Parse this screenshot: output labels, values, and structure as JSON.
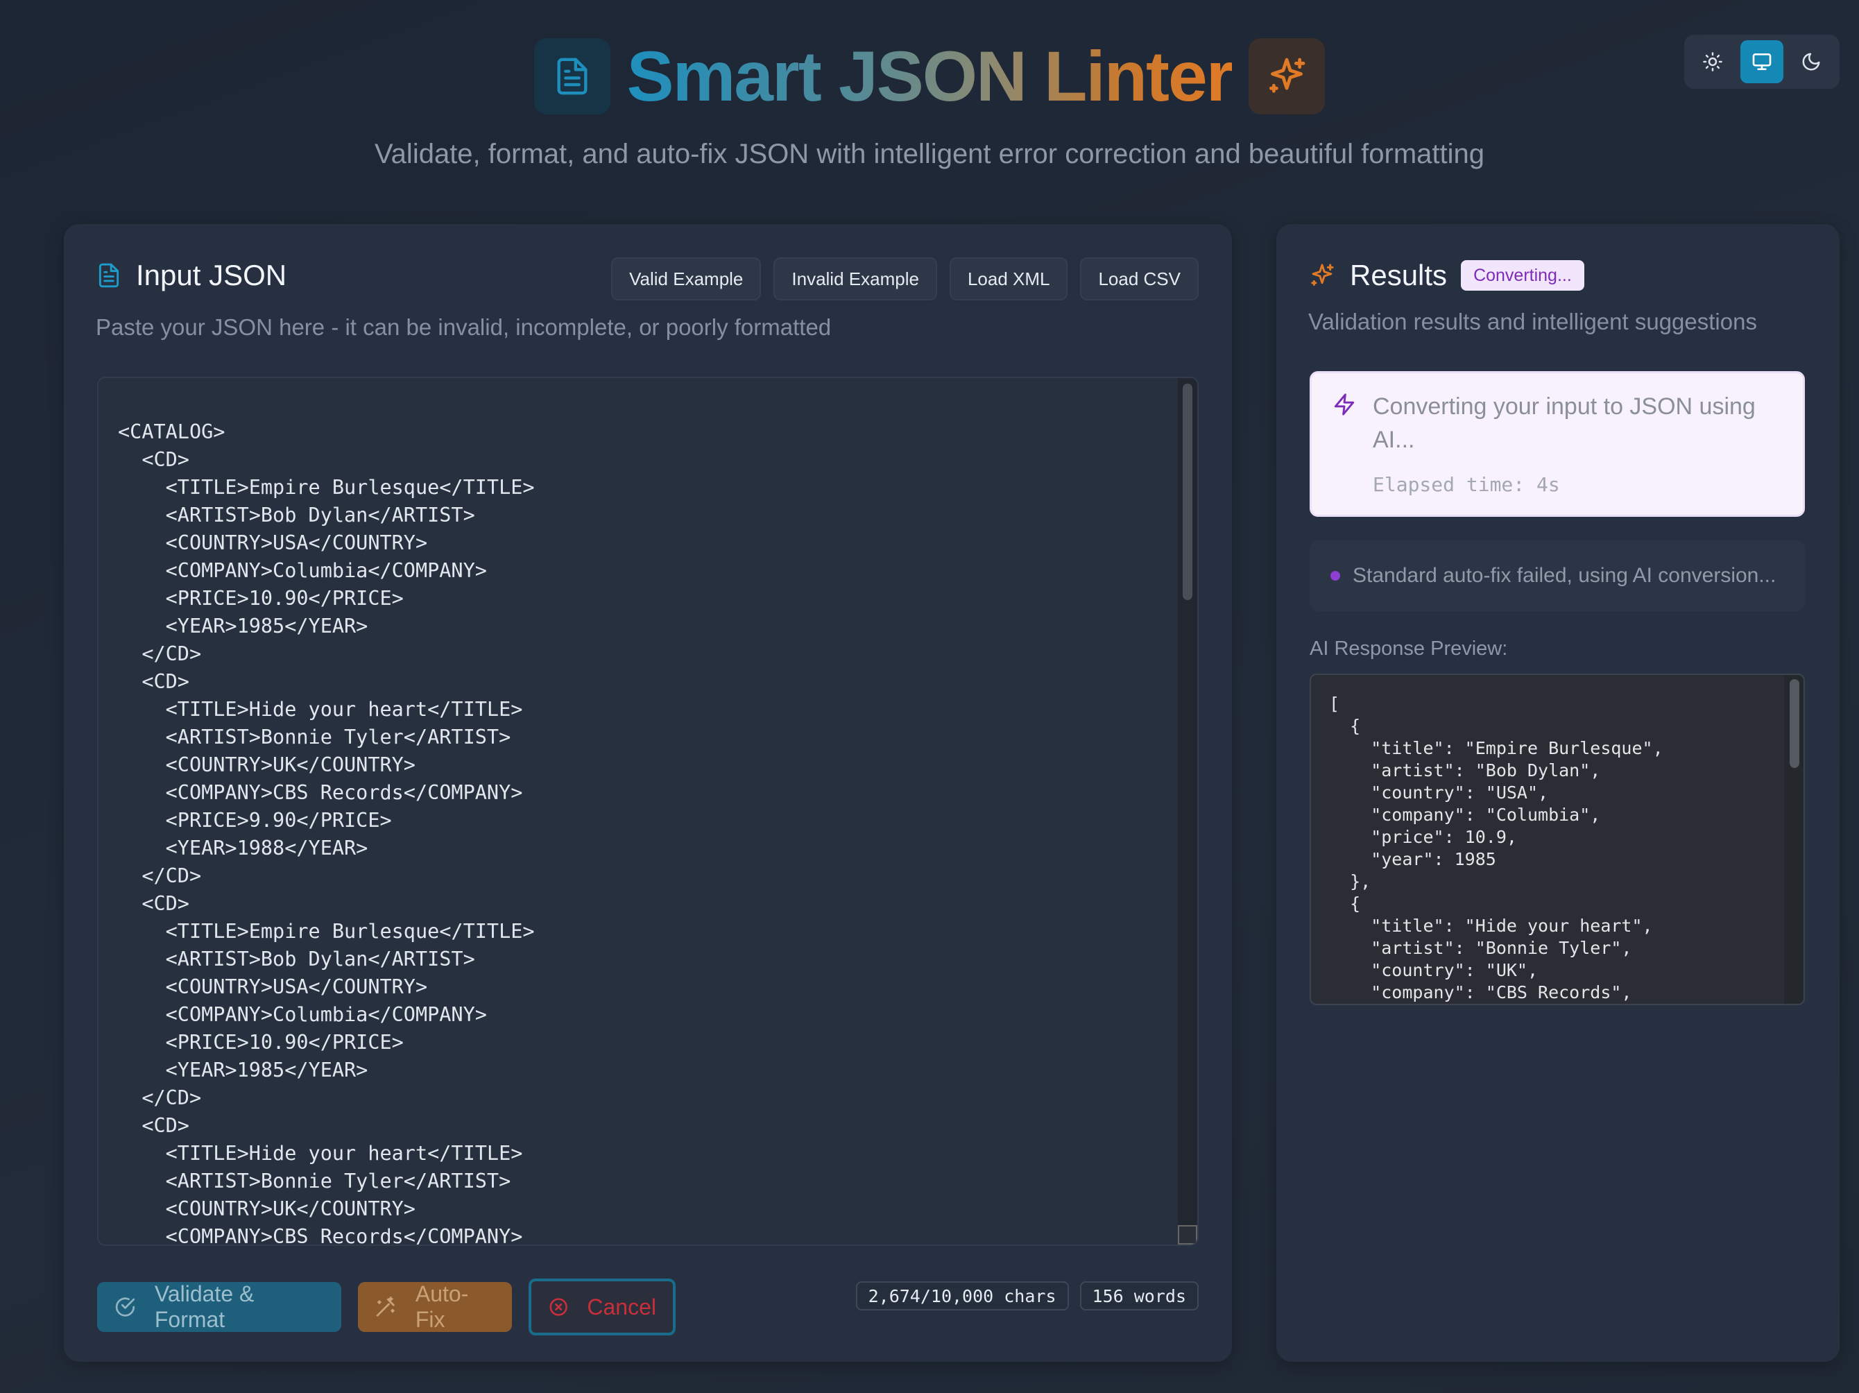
{
  "header": {
    "title": "Smart JSON Linter",
    "subtitle": "Validate, format, and auto-fix JSON with intelligent error correction and beautiful formatting",
    "theme_options": [
      "light",
      "system",
      "dark"
    ],
    "active_theme": "system"
  },
  "input_panel": {
    "title": "Input JSON",
    "description": "Paste your JSON here - it can be invalid, incomplete, or poorly formatted",
    "example_buttons": [
      "Valid Example",
      "Invalid Example",
      "Load XML",
      "Load CSV"
    ],
    "editor_content": "<CATALOG>\n  <CD>\n    <TITLE>Empire Burlesque</TITLE>\n    <ARTIST>Bob Dylan</ARTIST>\n    <COUNTRY>USA</COUNTRY>\n    <COMPANY>Columbia</COMPANY>\n    <PRICE>10.90</PRICE>\n    <YEAR>1985</YEAR>\n  </CD>\n  <CD>\n    <TITLE>Hide your heart</TITLE>\n    <ARTIST>Bonnie Tyler</ARTIST>\n    <COUNTRY>UK</COUNTRY>\n    <COMPANY>CBS Records</COMPANY>\n    <PRICE>9.90</PRICE>\n    <YEAR>1988</YEAR>\n  </CD>\n  <CD>\n    <TITLE>Empire Burlesque</TITLE>\n    <ARTIST>Bob Dylan</ARTIST>\n    <COUNTRY>USA</COUNTRY>\n    <COMPANY>Columbia</COMPANY>\n    <PRICE>10.90</PRICE>\n    <YEAR>1985</YEAR>\n  </CD>\n  <CD>\n    <TITLE>Hide your heart</TITLE>\n    <ARTIST>Bonnie Tyler</ARTIST>\n    <COUNTRY>UK</COUNTRY>\n    <COMPANY>CBS Records</COMPANY>",
    "actions": {
      "validate_label": "Validate & Format",
      "autofix_label": "Auto-Fix",
      "cancel_label": "Cancel"
    },
    "char_count": "2,674/10,000 chars",
    "word_count": "156 words"
  },
  "results_panel": {
    "title": "Results",
    "status_badge": "Converting...",
    "description": "Validation results and intelligent suggestions",
    "converting_message": "Converting your input to JSON using AI...",
    "elapsed_time": "Elapsed time: 4s",
    "log_message": "Standard auto-fix failed, using AI conversion...",
    "preview_label": "AI Response Preview:",
    "preview_content": "[\n  {\n    \"title\": \"Empire Burlesque\",\n    \"artist\": \"Bob Dylan\",\n    \"country\": \"USA\",\n    \"company\": \"Columbia\",\n    \"price\": 10.9,\n    \"year\": 1985\n  },\n  {\n    \"title\": \"Hide your heart\",\n    \"artist\": \"Bonnie Tyler\",\n    \"country\": \"UK\",\n    \"company\": \"CBS Records\","
  },
  "colors": {
    "accent_blue": "#1589b5",
    "accent_orange": "#e07a26",
    "status_purple": "#7d2cb8",
    "cancel_red": "#c92f3a"
  }
}
